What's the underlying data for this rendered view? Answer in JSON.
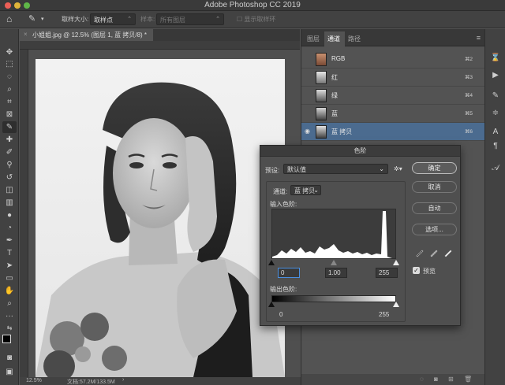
{
  "app": {
    "title": "Adobe Photoshop CC 2019"
  },
  "options_bar": {
    "sample_size_label": "取样大小:",
    "sample_size_value": "取样点",
    "sample_label": "样本:",
    "sample_value": "所有图层",
    "show_ring_label": "显示取样环"
  },
  "document": {
    "tab_title": "小姐姐.jpg @ 12.5% (图层 1, 蓝 拷贝/8) *",
    "zoom": "12.5%",
    "doc_size": "文档:57.2M/133.5M"
  },
  "channels_panel": {
    "tabs": [
      "图层",
      "通道",
      "路径"
    ],
    "active_tab": "通道",
    "channels": [
      {
        "name": "RGB",
        "shortcut": "⌘2",
        "selected": false
      },
      {
        "name": "红",
        "shortcut": "⌘3",
        "selected": false
      },
      {
        "name": "绿",
        "shortcut": "⌘4",
        "selected": false
      },
      {
        "name": "蓝",
        "shortcut": "⌘5",
        "selected": false
      },
      {
        "name": "蓝 拷贝",
        "shortcut": "⌘6",
        "selected": true
      }
    ]
  },
  "levels_dialog": {
    "title": "色阶",
    "preset_label": "预设:",
    "preset_value": "默认值",
    "channel_label": "通道:",
    "channel_value": "蓝 拷贝",
    "input_levels_label": "输入色阶:",
    "input_black": "0",
    "input_gamma": "1.00",
    "input_white": "255",
    "output_levels_label": "输出色阶:",
    "output_black": "0",
    "output_white": "255",
    "buttons": {
      "ok": "确定",
      "cancel": "取消",
      "auto": "自动",
      "options": "选项..."
    },
    "preview_label": "预览",
    "preview_checked": true
  },
  "colors": {
    "accent": "#4b6b8f",
    "focus": "#4a8fe0"
  }
}
